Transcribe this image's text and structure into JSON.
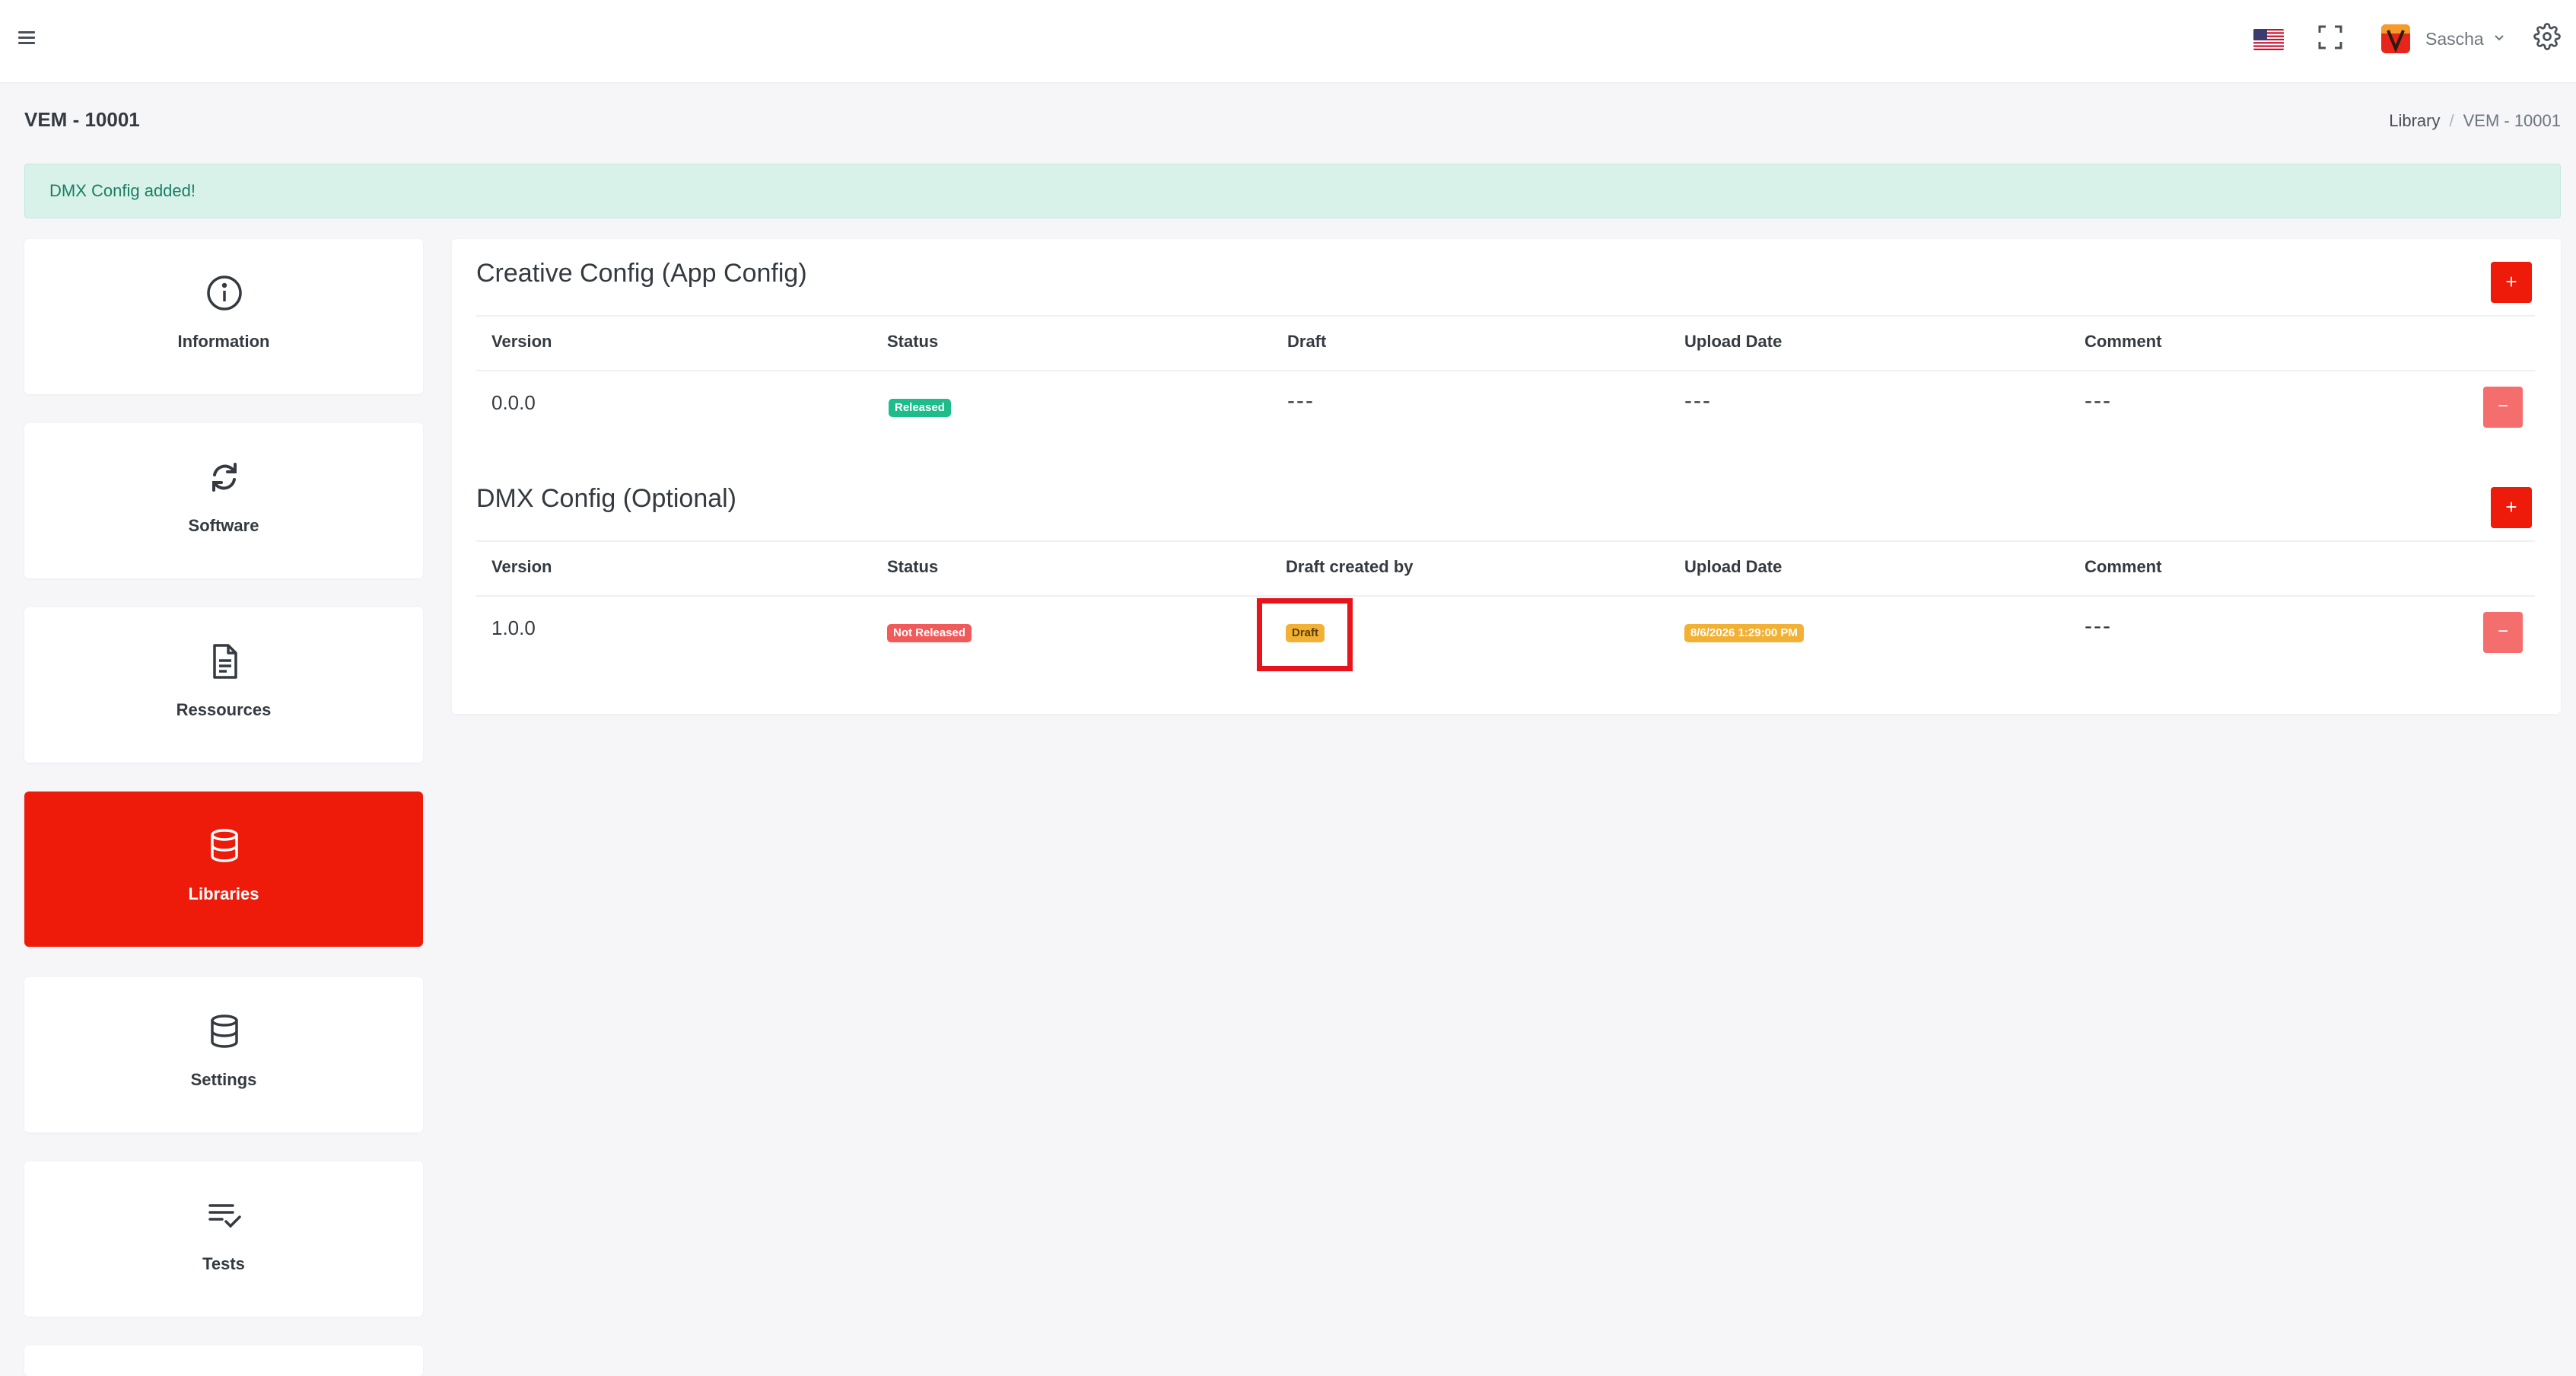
{
  "topbar": {
    "username": "Sascha",
    "flag_icon": "us-flag-icon",
    "fullscreen_icon": "fullscreen-icon",
    "settings_icon": "gear-icon"
  },
  "page": {
    "title": "VEM - 10001",
    "breadcrumb": [
      "Library",
      "VEM - 10001"
    ]
  },
  "alert": {
    "message": "DMX Config added!"
  },
  "sidebar": {
    "items": [
      {
        "label": "Information",
        "icon": "info-icon"
      },
      {
        "label": "Software",
        "icon": "sync-icon"
      },
      {
        "label": "Ressources",
        "icon": "document-icon"
      },
      {
        "label": "Libraries",
        "icon": "database-icon",
        "active": true
      },
      {
        "label": "Settings",
        "icon": "database-icon"
      },
      {
        "label": "Tests",
        "icon": "checklist-icon"
      }
    ]
  },
  "creative_config": {
    "title": "Creative Config (App Config)",
    "add_label": "+",
    "columns": [
      "Version",
      "Status",
      "Draft",
      "Upload Date",
      "Comment"
    ],
    "rows": [
      {
        "version": "0.0.0",
        "status": "Released",
        "draft": "---",
        "upload_date": "---",
        "comment": "---",
        "remove_label": "−"
      }
    ]
  },
  "dmx_config": {
    "title": "DMX Config (Optional)",
    "add_label": "+",
    "columns": [
      "Version",
      "Status",
      "Draft created by",
      "Upload Date",
      "Comment"
    ],
    "rows": [
      {
        "version": "1.0.0",
        "status": "Not Released",
        "draft": "Draft",
        "upload_date": "8/6/2026 1:29:00 PM",
        "comment": "---",
        "remove_label": "−"
      }
    ]
  },
  "colors": {
    "accent": "#ee1b0b",
    "success": "#1ebc8a",
    "danger": "#f25a5a",
    "warning": "#f2b134",
    "alert_bg": "#d8f2ea"
  }
}
